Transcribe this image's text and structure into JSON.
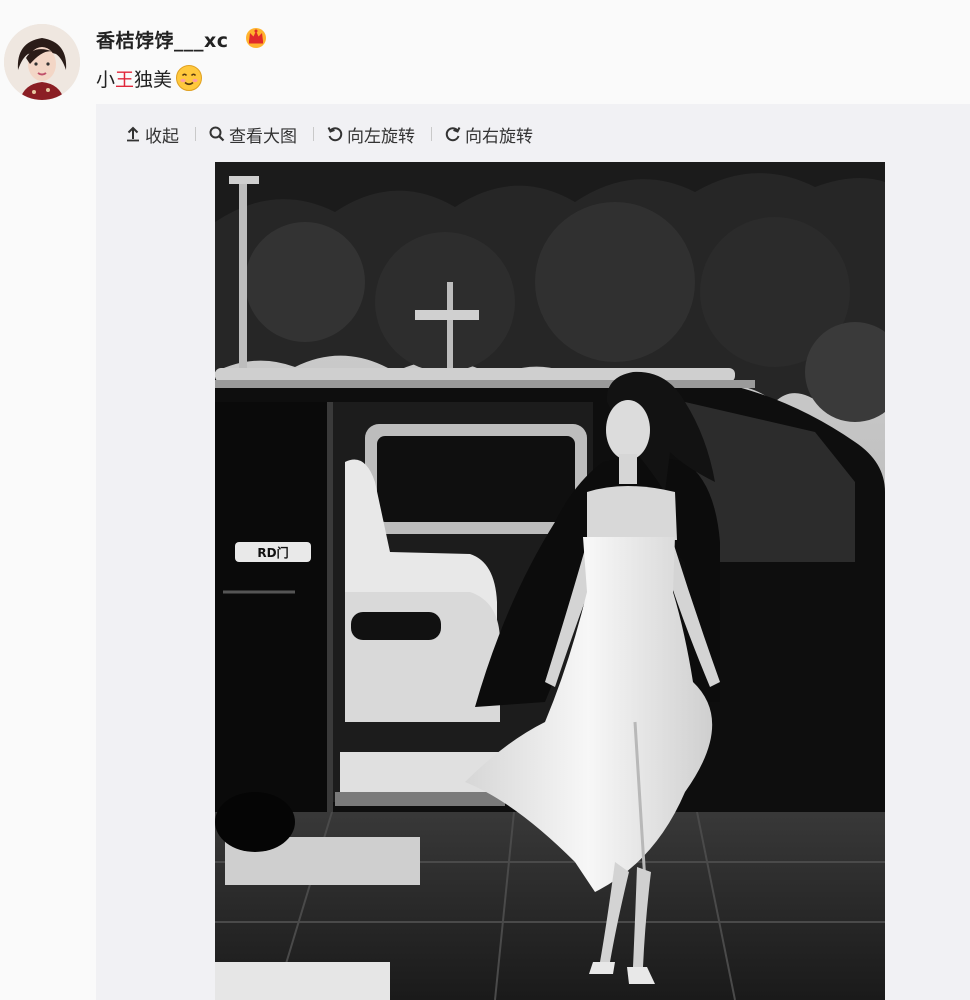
{
  "post": {
    "username": "香桔饽饽___xc",
    "text_before": "小",
    "text_highlight": "王",
    "text_after": "独美",
    "emoji": "smile-emoji",
    "badge_icon": "crown-icon"
  },
  "toolbar": {
    "items": [
      {
        "label": "收起",
        "icon": "collapse-up-icon"
      },
      {
        "label": "查看大图",
        "icon": "search-icon"
      },
      {
        "label": "向左旋转",
        "icon": "rotate-left-icon"
      },
      {
        "label": "向右旋转",
        "icon": "rotate-right-icon"
      }
    ]
  },
  "photo": {
    "plate_text": "RD门"
  },
  "colors": {
    "highlight": "#e0273b",
    "panel_bg": "#f1f1f4",
    "page_bg": "#fafafa"
  }
}
